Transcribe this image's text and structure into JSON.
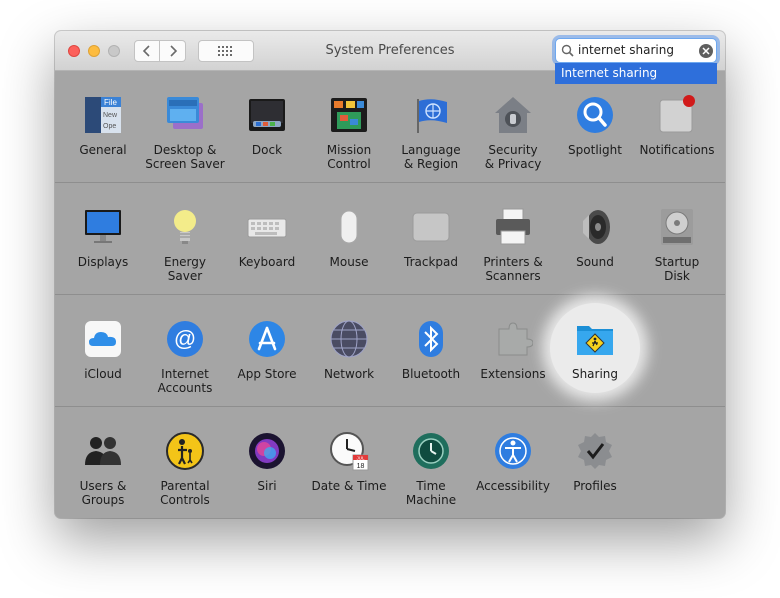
{
  "window": {
    "title": "System Preferences"
  },
  "search": {
    "value": "internet sharing",
    "suggestion": "Internet sharing"
  },
  "rows": [
    [
      {
        "name": "general",
        "label": "General",
        "icon": "general-icon"
      },
      {
        "name": "desktop-screen-saver",
        "label": "Desktop &\nScreen Saver",
        "icon": "desktop-icon"
      },
      {
        "name": "dock",
        "label": "Dock",
        "icon": "dock-icon"
      },
      {
        "name": "mission-control",
        "label": "Mission\nControl",
        "icon": "mission-control-icon"
      },
      {
        "name": "language-region",
        "label": "Language\n& Region",
        "icon": "flag-icon"
      },
      {
        "name": "security-privacy",
        "label": "Security\n& Privacy",
        "icon": "house-lock-icon"
      },
      {
        "name": "spotlight",
        "label": "Spotlight",
        "icon": "magnifier-icon"
      },
      {
        "name": "notifications",
        "label": "Notifications",
        "icon": "notifications-icon"
      }
    ],
    [
      {
        "name": "displays",
        "label": "Displays",
        "icon": "monitor-icon"
      },
      {
        "name": "energy-saver",
        "label": "Energy\nSaver",
        "icon": "lightbulb-icon"
      },
      {
        "name": "keyboard",
        "label": "Keyboard",
        "icon": "keyboard-icon"
      },
      {
        "name": "mouse",
        "label": "Mouse",
        "icon": "mouse-icon"
      },
      {
        "name": "trackpad",
        "label": "Trackpad",
        "icon": "trackpad-icon"
      },
      {
        "name": "printers-scanners",
        "label": "Printers &\nScanners",
        "icon": "printer-icon"
      },
      {
        "name": "sound",
        "label": "Sound",
        "icon": "speaker-icon"
      },
      {
        "name": "startup-disk",
        "label": "Startup\nDisk",
        "icon": "disk-icon"
      }
    ],
    [
      {
        "name": "icloud",
        "label": "iCloud",
        "icon": "cloud-icon"
      },
      {
        "name": "internet-accounts",
        "label": "Internet\nAccounts",
        "icon": "at-sign-icon"
      },
      {
        "name": "app-store",
        "label": "App Store",
        "icon": "app-store-icon"
      },
      {
        "name": "network",
        "label": "Network",
        "icon": "globe-icon"
      },
      {
        "name": "bluetooth",
        "label": "Bluetooth",
        "icon": "bluetooth-icon"
      },
      {
        "name": "extensions",
        "label": "Extensions",
        "icon": "puzzle-icon"
      },
      {
        "name": "sharing",
        "label": "Sharing",
        "icon": "sharing-folder-icon"
      }
    ],
    [
      {
        "name": "users-groups",
        "label": "Users &\nGroups",
        "icon": "users-icon"
      },
      {
        "name": "parental-controls",
        "label": "Parental\nControls",
        "icon": "parental-icon"
      },
      {
        "name": "siri",
        "label": "Siri",
        "icon": "siri-icon"
      },
      {
        "name": "date-time",
        "label": "Date & Time",
        "icon": "clock-calendar-icon"
      },
      {
        "name": "time-machine",
        "label": "Time\nMachine",
        "icon": "time-machine-icon"
      },
      {
        "name": "accessibility",
        "label": "Accessibility",
        "icon": "accessibility-icon"
      },
      {
        "name": "profiles",
        "label": "Profiles",
        "icon": "badge-check-icon"
      }
    ]
  ],
  "icon_text": {
    "general_file": "File",
    "general_new": "New",
    "general_ope": "Ope",
    "calendar_month": "JUL",
    "calendar_day": "18"
  }
}
